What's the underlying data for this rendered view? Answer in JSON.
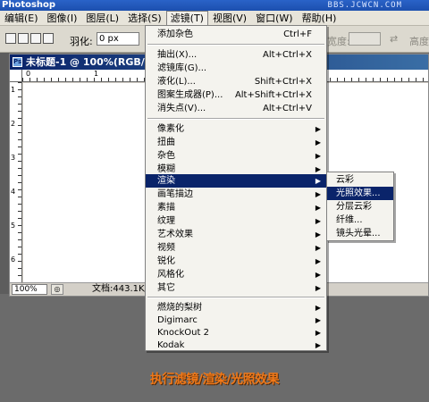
{
  "app": {
    "title": "Photoshop",
    "watermark": "BBS.JCWCN.COM"
  },
  "menubar": {
    "items": [
      {
        "label": "编辑(E)"
      },
      {
        "label": "图像(I)"
      },
      {
        "label": "图层(L)"
      },
      {
        "label": "选择(S)"
      },
      {
        "label": "滤镜(T)"
      },
      {
        "label": "视图(V)"
      },
      {
        "label": "窗口(W)"
      },
      {
        "label": "帮助(H)"
      }
    ]
  },
  "options": {
    "feather_label": "羽化:",
    "feather_value": "0 px",
    "width_label": "宽度:",
    "height_label": "高度"
  },
  "document": {
    "title": "未标题-1 @ 100%(RGB/8)",
    "hruler_labels": [
      "0",
      "1"
    ],
    "vruler_labels": [
      "1",
      "2",
      "3",
      "4",
      "5",
      "6"
    ],
    "zoom": "100%",
    "doc_size": "文档:443.1K/"
  },
  "filter_menu": {
    "items": [
      {
        "label": "添加杂色",
        "shortcut": "Ctrl+F",
        "submenu": false
      },
      {
        "label": "抽出(X)...",
        "shortcut": "Alt+Ctrl+X",
        "submenu": false
      },
      {
        "label": "滤镜库(G)...",
        "shortcut": "",
        "submenu": false
      },
      {
        "label": "液化(L)...",
        "shortcut": "Shift+Ctrl+X",
        "submenu": false
      },
      {
        "label": "图案生成器(P)...",
        "shortcut": "Alt+Shift+Ctrl+X",
        "submenu": false
      },
      {
        "label": "消失点(V)...",
        "shortcut": "Alt+Ctrl+V",
        "submenu": false
      },
      {
        "label": "像素化",
        "shortcut": "",
        "submenu": true
      },
      {
        "label": "扭曲",
        "shortcut": "",
        "submenu": true
      },
      {
        "label": "杂色",
        "shortcut": "",
        "submenu": true
      },
      {
        "label": "模糊",
        "shortcut": "",
        "submenu": true
      },
      {
        "label": "渲染",
        "shortcut": "",
        "submenu": true,
        "highlighted": true
      },
      {
        "label": "画笔描边",
        "shortcut": "",
        "submenu": true
      },
      {
        "label": "素描",
        "shortcut": "",
        "submenu": true
      },
      {
        "label": "纹理",
        "shortcut": "",
        "submenu": true
      },
      {
        "label": "艺术效果",
        "shortcut": "",
        "submenu": true
      },
      {
        "label": "视频",
        "shortcut": "",
        "submenu": true
      },
      {
        "label": "锐化",
        "shortcut": "",
        "submenu": true
      },
      {
        "label": "风格化",
        "shortcut": "",
        "submenu": true
      },
      {
        "label": "其它",
        "shortcut": "",
        "submenu": true
      },
      {
        "label": "燃烧的梨树",
        "shortcut": "",
        "submenu": true
      },
      {
        "label": "Digimarc",
        "shortcut": "",
        "submenu": true
      },
      {
        "label": "KnockOut 2",
        "shortcut": "",
        "submenu": true
      },
      {
        "label": "Kodak",
        "shortcut": "",
        "submenu": true
      }
    ]
  },
  "render_submenu": {
    "items": [
      {
        "label": "云彩"
      },
      {
        "label": "光照效果...",
        "highlighted": true
      },
      {
        "label": "分层云彩"
      },
      {
        "label": "纤维..."
      },
      {
        "label": "镜头光晕..."
      }
    ]
  },
  "caption": "执行滤镜/渲染/光照效果",
  "colors": {
    "highlight": "#0a246a",
    "caption": "#f07818",
    "menu_bg": "#f4f3ee"
  }
}
